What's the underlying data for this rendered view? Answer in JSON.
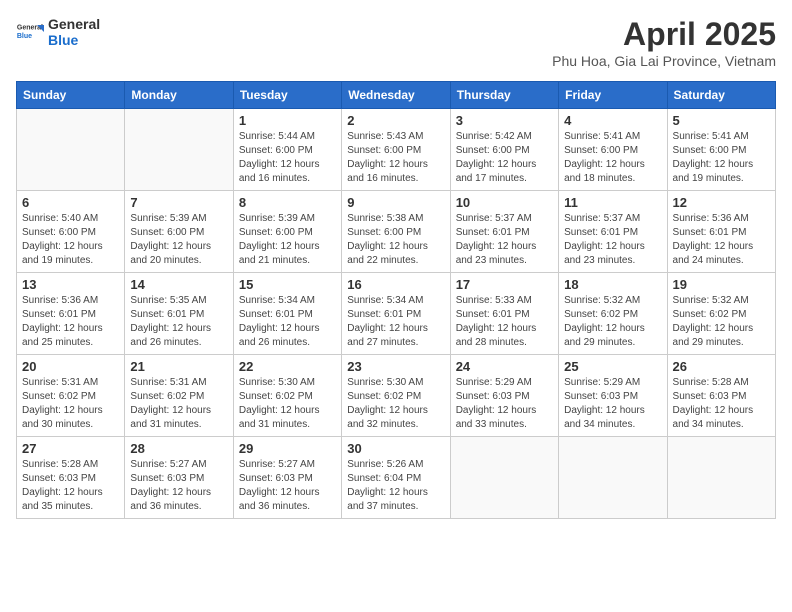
{
  "header": {
    "logo_general": "General",
    "logo_blue": "Blue",
    "month_title": "April 2025",
    "location": "Phu Hoa, Gia Lai Province, Vietnam"
  },
  "weekdays": [
    "Sunday",
    "Monday",
    "Tuesday",
    "Wednesday",
    "Thursday",
    "Friday",
    "Saturday"
  ],
  "weeks": [
    [
      {
        "day": "",
        "info": ""
      },
      {
        "day": "",
        "info": ""
      },
      {
        "day": "1",
        "info": "Sunrise: 5:44 AM\nSunset: 6:00 PM\nDaylight: 12 hours and 16 minutes."
      },
      {
        "day": "2",
        "info": "Sunrise: 5:43 AM\nSunset: 6:00 PM\nDaylight: 12 hours and 16 minutes."
      },
      {
        "day": "3",
        "info": "Sunrise: 5:42 AM\nSunset: 6:00 PM\nDaylight: 12 hours and 17 minutes."
      },
      {
        "day": "4",
        "info": "Sunrise: 5:41 AM\nSunset: 6:00 PM\nDaylight: 12 hours and 18 minutes."
      },
      {
        "day": "5",
        "info": "Sunrise: 5:41 AM\nSunset: 6:00 PM\nDaylight: 12 hours and 19 minutes."
      }
    ],
    [
      {
        "day": "6",
        "info": "Sunrise: 5:40 AM\nSunset: 6:00 PM\nDaylight: 12 hours and 19 minutes."
      },
      {
        "day": "7",
        "info": "Sunrise: 5:39 AM\nSunset: 6:00 PM\nDaylight: 12 hours and 20 minutes."
      },
      {
        "day": "8",
        "info": "Sunrise: 5:39 AM\nSunset: 6:00 PM\nDaylight: 12 hours and 21 minutes."
      },
      {
        "day": "9",
        "info": "Sunrise: 5:38 AM\nSunset: 6:00 PM\nDaylight: 12 hours and 22 minutes."
      },
      {
        "day": "10",
        "info": "Sunrise: 5:37 AM\nSunset: 6:01 PM\nDaylight: 12 hours and 23 minutes."
      },
      {
        "day": "11",
        "info": "Sunrise: 5:37 AM\nSunset: 6:01 PM\nDaylight: 12 hours and 23 minutes."
      },
      {
        "day": "12",
        "info": "Sunrise: 5:36 AM\nSunset: 6:01 PM\nDaylight: 12 hours and 24 minutes."
      }
    ],
    [
      {
        "day": "13",
        "info": "Sunrise: 5:36 AM\nSunset: 6:01 PM\nDaylight: 12 hours and 25 minutes."
      },
      {
        "day": "14",
        "info": "Sunrise: 5:35 AM\nSunset: 6:01 PM\nDaylight: 12 hours and 26 minutes."
      },
      {
        "day": "15",
        "info": "Sunrise: 5:34 AM\nSunset: 6:01 PM\nDaylight: 12 hours and 26 minutes."
      },
      {
        "day": "16",
        "info": "Sunrise: 5:34 AM\nSunset: 6:01 PM\nDaylight: 12 hours and 27 minutes."
      },
      {
        "day": "17",
        "info": "Sunrise: 5:33 AM\nSunset: 6:01 PM\nDaylight: 12 hours and 28 minutes."
      },
      {
        "day": "18",
        "info": "Sunrise: 5:32 AM\nSunset: 6:02 PM\nDaylight: 12 hours and 29 minutes."
      },
      {
        "day": "19",
        "info": "Sunrise: 5:32 AM\nSunset: 6:02 PM\nDaylight: 12 hours and 29 minutes."
      }
    ],
    [
      {
        "day": "20",
        "info": "Sunrise: 5:31 AM\nSunset: 6:02 PM\nDaylight: 12 hours and 30 minutes."
      },
      {
        "day": "21",
        "info": "Sunrise: 5:31 AM\nSunset: 6:02 PM\nDaylight: 12 hours and 31 minutes."
      },
      {
        "day": "22",
        "info": "Sunrise: 5:30 AM\nSunset: 6:02 PM\nDaylight: 12 hours and 31 minutes."
      },
      {
        "day": "23",
        "info": "Sunrise: 5:30 AM\nSunset: 6:02 PM\nDaylight: 12 hours and 32 minutes."
      },
      {
        "day": "24",
        "info": "Sunrise: 5:29 AM\nSunset: 6:03 PM\nDaylight: 12 hours and 33 minutes."
      },
      {
        "day": "25",
        "info": "Sunrise: 5:29 AM\nSunset: 6:03 PM\nDaylight: 12 hours and 34 minutes."
      },
      {
        "day": "26",
        "info": "Sunrise: 5:28 AM\nSunset: 6:03 PM\nDaylight: 12 hours and 34 minutes."
      }
    ],
    [
      {
        "day": "27",
        "info": "Sunrise: 5:28 AM\nSunset: 6:03 PM\nDaylight: 12 hours and 35 minutes."
      },
      {
        "day": "28",
        "info": "Sunrise: 5:27 AM\nSunset: 6:03 PM\nDaylight: 12 hours and 36 minutes."
      },
      {
        "day": "29",
        "info": "Sunrise: 5:27 AM\nSunset: 6:03 PM\nDaylight: 12 hours and 36 minutes."
      },
      {
        "day": "30",
        "info": "Sunrise: 5:26 AM\nSunset: 6:04 PM\nDaylight: 12 hours and 37 minutes."
      },
      {
        "day": "",
        "info": ""
      },
      {
        "day": "",
        "info": ""
      },
      {
        "day": "",
        "info": ""
      }
    ]
  ]
}
